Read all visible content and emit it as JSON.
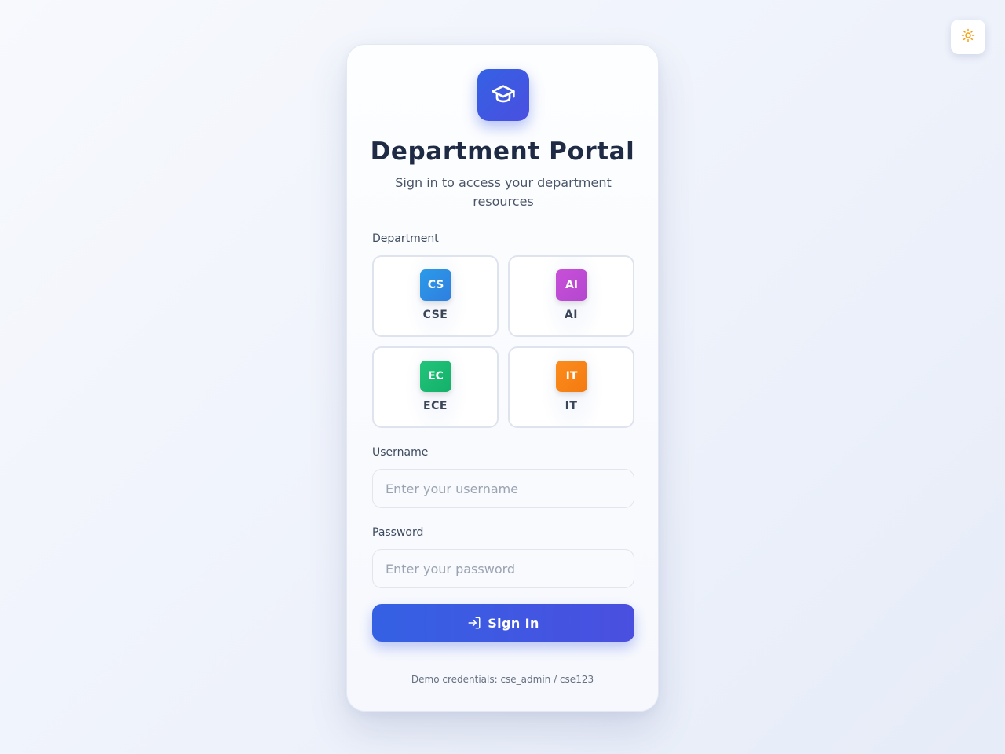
{
  "theme_toggle": {
    "icon": "sun-icon",
    "color": "#f59e0b"
  },
  "logo": {
    "icon": "graduation-cap-icon"
  },
  "header": {
    "title": "Department Portal",
    "subtitle": "Sign in to access your department resources"
  },
  "department": {
    "label": "Department",
    "options": [
      {
        "code": "CS",
        "name": "CSE",
        "color_from": "#2b9ae8",
        "color_to": "#2f7fe0"
      },
      {
        "code": "AI",
        "name": "AI",
        "color_from": "#c84fd8",
        "color_to": "#b447cf"
      },
      {
        "code": "EC",
        "name": "ECE",
        "color_from": "#22c47a",
        "color_to": "#13b06a"
      },
      {
        "code": "IT",
        "name": "IT",
        "color_from": "#fb8c1d",
        "color_to": "#f47a10"
      }
    ]
  },
  "username": {
    "label": "Username",
    "value": "",
    "placeholder": "Enter your username"
  },
  "password": {
    "label": "Password",
    "value": "",
    "placeholder": "Enter your password"
  },
  "signin": {
    "label": "Sign In",
    "icon": "log-in-icon"
  },
  "footer": {
    "demo_note": "Demo credentials: cse_admin / cse123"
  },
  "colors": {
    "accent": "#3b5be6",
    "title": "#1f2a44"
  }
}
